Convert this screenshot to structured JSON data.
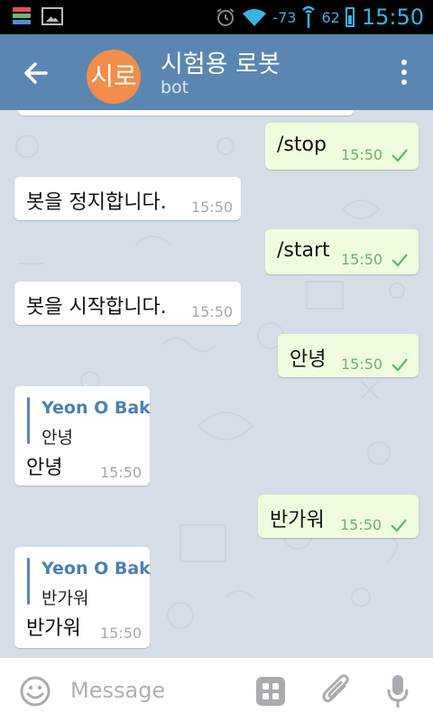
{
  "status_bar": {
    "signal": "-73",
    "battery": "62",
    "time": "15:50"
  },
  "header": {
    "avatar_text": "시로",
    "title": "시험용 로봇",
    "subtitle": "bot"
  },
  "messages": [
    {
      "direction": "out",
      "text": "/stop",
      "time": "15:50"
    },
    {
      "direction": "in",
      "text": "봇을 정지합니다.",
      "time": "15:50"
    },
    {
      "direction": "out",
      "text": "/start",
      "time": "15:50"
    },
    {
      "direction": "in",
      "text": "봇을 시작합니다.",
      "time": "15:50"
    },
    {
      "direction": "out",
      "text": "안녕",
      "time": "15:50"
    },
    {
      "direction": "in",
      "reply_name": "Yeon O Bak",
      "reply_text": "안녕",
      "text": "안녕",
      "time": "15:50"
    },
    {
      "direction": "out",
      "text": "반가워",
      "time": "15:50"
    },
    {
      "direction": "in",
      "reply_name": "Yeon O Bak",
      "reply_text": "반가워",
      "text": "반가워",
      "time": "15:50"
    }
  ],
  "input": {
    "placeholder": "Message"
  },
  "colors": {
    "header": "#5b86b2",
    "avatar": "#f28d4b",
    "chat_background": "#d5dde6",
    "outgoing_bubble": "#effdde",
    "incoming_bubble": "#ffffff",
    "accent": "#33b5e5"
  },
  "icons": [
    "app-icon",
    "gallery-icon",
    "alarm-icon",
    "wifi-icon",
    "signal-icon",
    "battery-icon",
    "back-arrow-icon",
    "more-vert-icon",
    "check-icon",
    "emoji-icon",
    "bot-keyboard-icon",
    "attach-icon",
    "mic-icon"
  ]
}
